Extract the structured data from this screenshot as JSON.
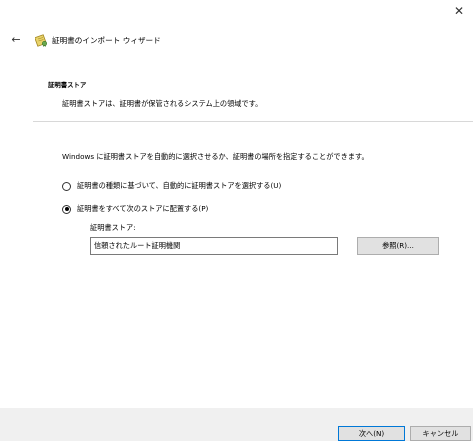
{
  "window": {
    "close_glyph": "✕",
    "back_glyph": "←",
    "title": "証明書のインポート ウィザード",
    "icon": "certificate-icon"
  },
  "section": {
    "heading": "証明書ストア",
    "description": "証明書ストアは、証明書が保管されるシステム上の領域です。"
  },
  "instruction": "Windows に証明書ストアを自動的に選択させるか、証明書の場所を指定することができます。",
  "options": [
    {
      "label": "証明書の種類に基づいて、自動的に証明書ストアを選択する(U)",
      "checked": false
    },
    {
      "label": "証明書をすべて次のストアに配置する(P)",
      "checked": true
    }
  ],
  "store": {
    "label": "証明書ストア:",
    "value": "信頼されたルート証明機関",
    "browse_label": "参照(R)..."
  },
  "footer": {
    "next_label": "次へ(N)",
    "cancel_label": "キャンセル"
  },
  "colors": {
    "footer_bg": "#f0f0f0",
    "accent_border": "#0078d7",
    "button_bg": "#e1e1e1"
  }
}
